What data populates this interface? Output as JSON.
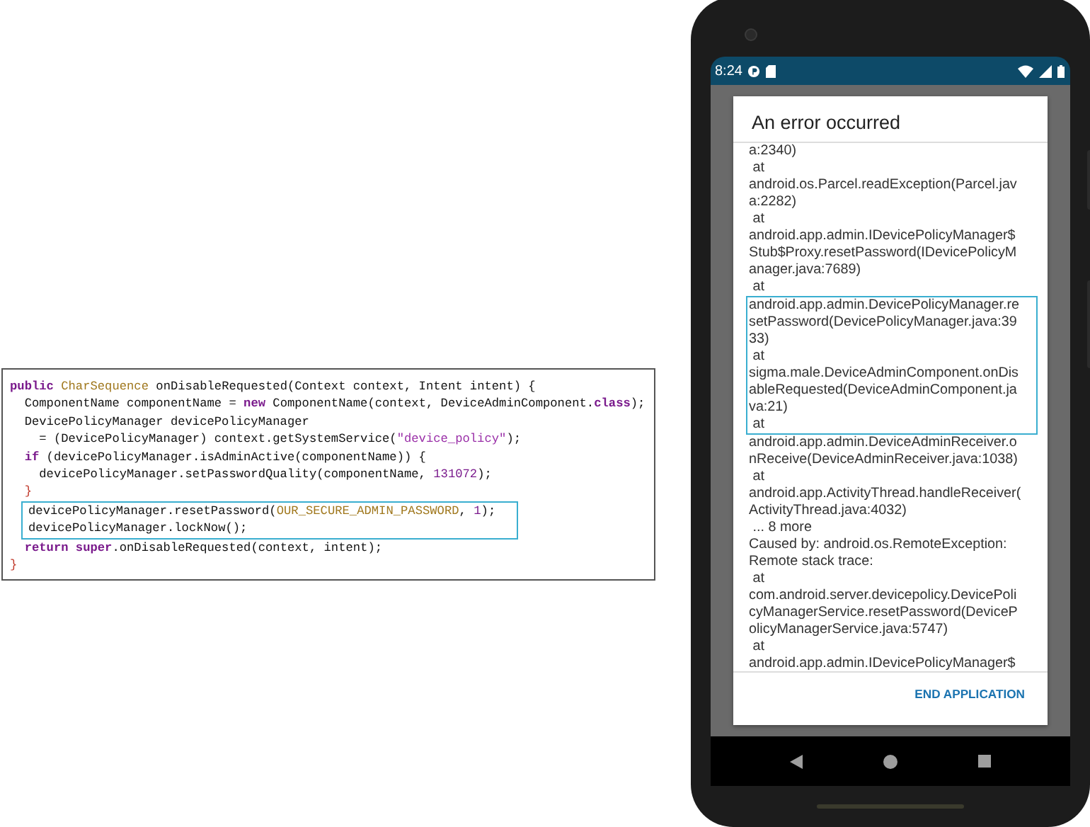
{
  "code_panel": {
    "blocks": [
      {
        "highlighted": false,
        "lines": [
          [
            {
              "text": "public",
              "kind": "keyword"
            },
            {
              "text": " CharSequence",
              "kind": "type"
            },
            {
              "text": " onDisableRequested(Context context, Intent intent) {",
              "kind": "plain"
            }
          ],
          [
            {
              "text": "  ComponentName componentName = ",
              "kind": "plain"
            },
            {
              "text": "new",
              "kind": "keyword"
            },
            {
              "text": " ComponentName(context, DeviceAdminComponent.",
              "kind": "plain"
            },
            {
              "text": "class",
              "kind": "keyword"
            },
            {
              "text": ");",
              "kind": "plain"
            }
          ],
          [
            {
              "text": "  DevicePolicyManager devicePolicyManager",
              "kind": "plain"
            }
          ],
          [
            {
              "text": "    = (DevicePolicyManager) context.getSystemService(",
              "kind": "plain"
            },
            {
              "text": "\"device_policy\"",
              "kind": "string"
            },
            {
              "text": ");",
              "kind": "plain"
            }
          ],
          [
            {
              "text": "  if",
              "kind": "keyword"
            },
            {
              "text": " (devicePolicyManager.isAdminActive(componentName)) {",
              "kind": "plain"
            }
          ],
          [
            {
              "text": "    devicePolicyManager.setPasswordQuality(componentName, ",
              "kind": "plain"
            },
            {
              "text": "131072",
              "kind": "number"
            },
            {
              "text": ");",
              "kind": "plain"
            }
          ],
          [
            {
              "text": "  }",
              "kind": "brace"
            }
          ]
        ]
      },
      {
        "highlighted": true,
        "lines": [
          [
            {
              "text": "devicePolicyManager.resetPassword(",
              "kind": "plain"
            },
            {
              "text": "OUR_SECURE_ADMIN_PASSWORD",
              "kind": "constant"
            },
            {
              "text": ", ",
              "kind": "plain"
            },
            {
              "text": "1",
              "kind": "number"
            },
            {
              "text": ");",
              "kind": "plain"
            }
          ],
          [
            {
              "text": "devicePolicyManager.lockNow();",
              "kind": "plain"
            }
          ]
        ]
      },
      {
        "highlighted": false,
        "lines": [
          [
            {
              "text": "  return super",
              "kind": "keyword"
            },
            {
              "text": ".onDisableRequested(context, intent);",
              "kind": "plain"
            }
          ],
          [
            {
              "text": "}",
              "kind": "brace"
            }
          ]
        ]
      }
    ]
  },
  "phone": {
    "status_bar": {
      "time": "8:24"
    },
    "dialog": {
      "title": "An error occurred",
      "blocks": [
        {
          "highlighted": false,
          "lines": [
            "a:2340)",
            " at",
            "android.os.Parcel.readException(Parcel.jav",
            "a:2282)",
            " at",
            "android.app.admin.IDevicePolicyManager$",
            "Stub$Proxy.resetPassword(IDevicePolicyM",
            "anager.java:7689)",
            " at"
          ]
        },
        {
          "highlighted": true,
          "lines": [
            "android.app.admin.DevicePolicyManager.re",
            "setPassword(DevicePolicyManager.java:39",
            "33)",
            " at",
            "sigma.male.DeviceAdminComponent.onDis",
            "ableRequested(DeviceAdminComponent.ja",
            "va:21)",
            " at"
          ]
        },
        {
          "highlighted": false,
          "lines": [
            "android.app.admin.DeviceAdminReceiver.o",
            "nReceive(DeviceAdminReceiver.java:1038)",
            " at",
            "android.app.ActivityThread.handleReceiver(",
            "ActivityThread.java:4032)",
            " ... 8 more",
            "Caused by: android.os.RemoteException:",
            "Remote stack trace:",
            " at",
            "com.android.server.devicepolicy.DevicePoli",
            "cyManagerService.resetPassword(DeviceP",
            "olicyManagerService.java:5747)",
            " at",
            "android.app.admin.IDevicePolicyManager$"
          ]
        }
      ],
      "button": "END APPLICATION"
    }
  }
}
